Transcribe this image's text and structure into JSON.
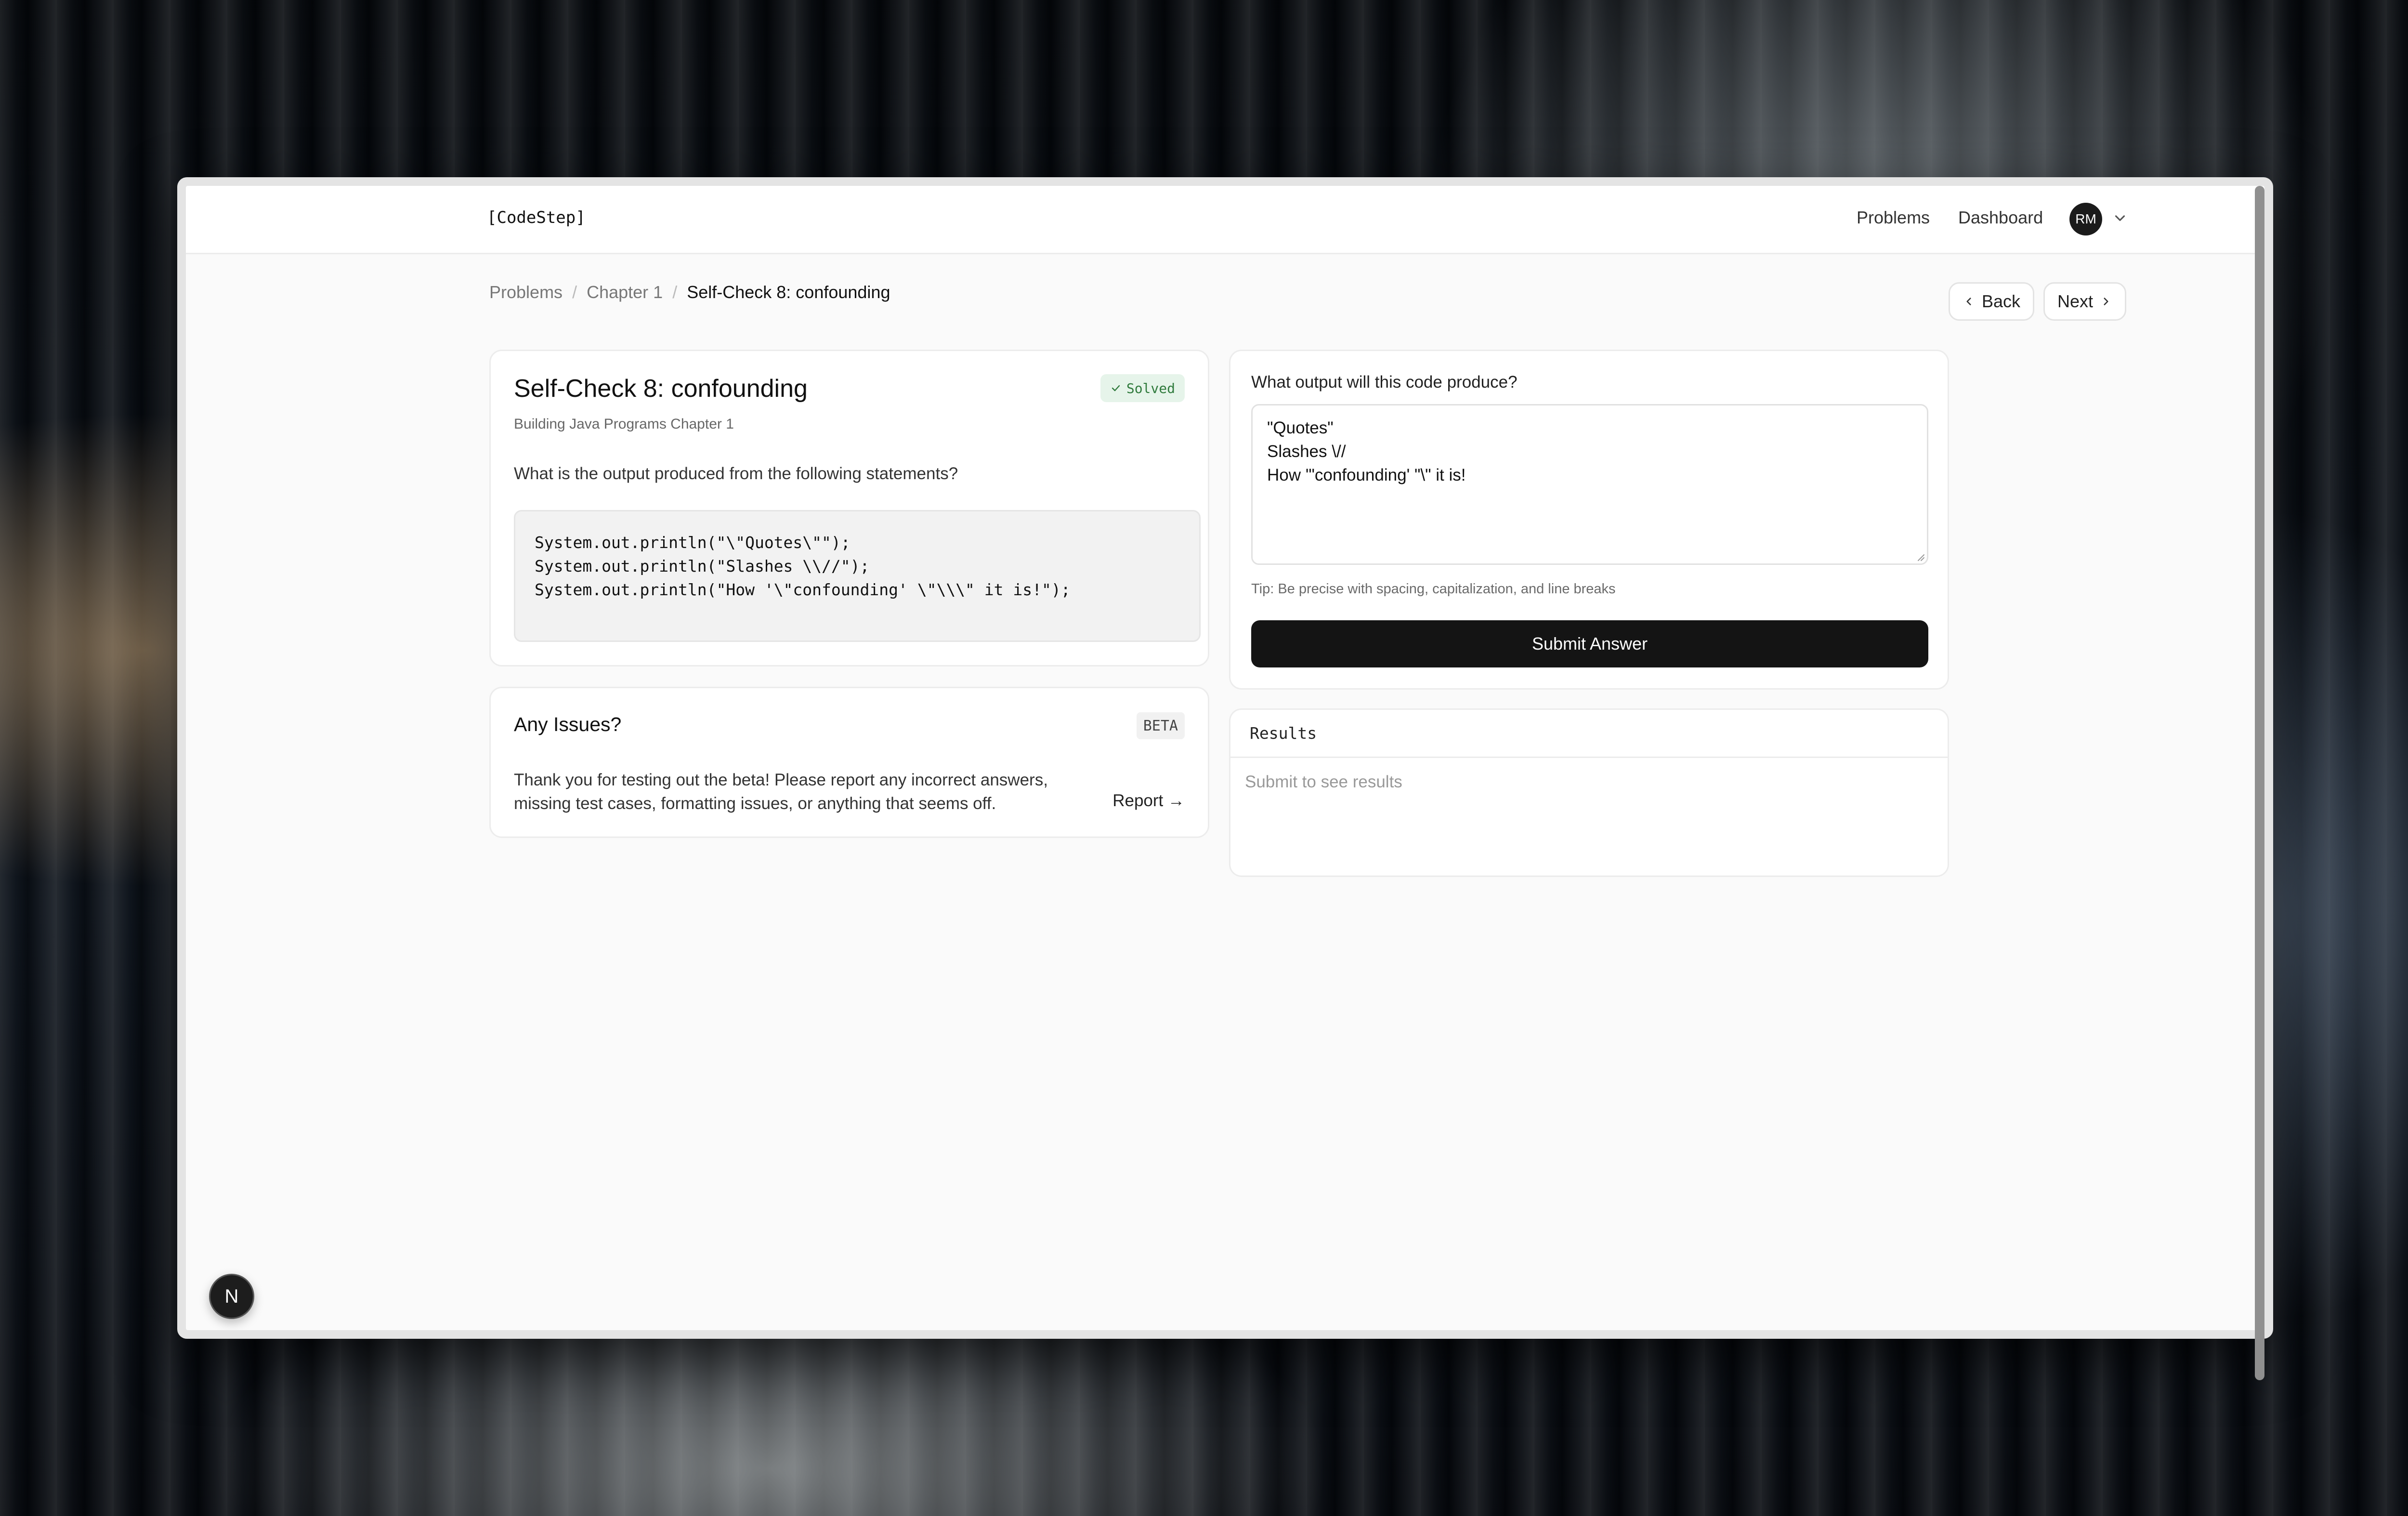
{
  "app": {
    "logo": "[CodeStep]"
  },
  "nav": {
    "problems": "Problems",
    "dashboard": "Dashboard",
    "avatar_initials": "RM"
  },
  "breadcrumb": {
    "items": [
      "Problems",
      "Chapter 1"
    ],
    "current": "Self-Check 8: confounding"
  },
  "pager": {
    "back": "Back",
    "next": "Next"
  },
  "problem": {
    "title": "Self-Check 8: confounding",
    "status": "Solved",
    "subtitle": "Building Java Programs Chapter 1",
    "question": "What is the output produced from the following statements?",
    "code": "System.out.println(\"\\\"Quotes\\\"\");\nSystem.out.println(\"Slashes \\\\//\");\nSystem.out.println(\"How '\\\"confounding' \\\"\\\\\\\" it is!\");"
  },
  "issues": {
    "title": "Any Issues?",
    "badge": "BETA",
    "text": "Thank you for testing out the beta! Please report any incorrect answers, missing test cases, formatting issues, or anything that seems off.",
    "report": "Report →"
  },
  "answer": {
    "label": "What output will this code produce?",
    "value": "\"Quotes\"\nSlashes \\//\nHow '\"confounding' \"\\\" it is!",
    "tip": "Tip: Be precise with spacing, capitalization, and line breaks",
    "submit": "Submit Answer"
  },
  "results": {
    "title": "Results",
    "empty": "Submit to see results"
  },
  "fab": {
    "label": "N"
  },
  "colors": {
    "primary": "#141414",
    "success_bg": "#e6f4ea",
    "success_text": "#2f7a3c"
  }
}
